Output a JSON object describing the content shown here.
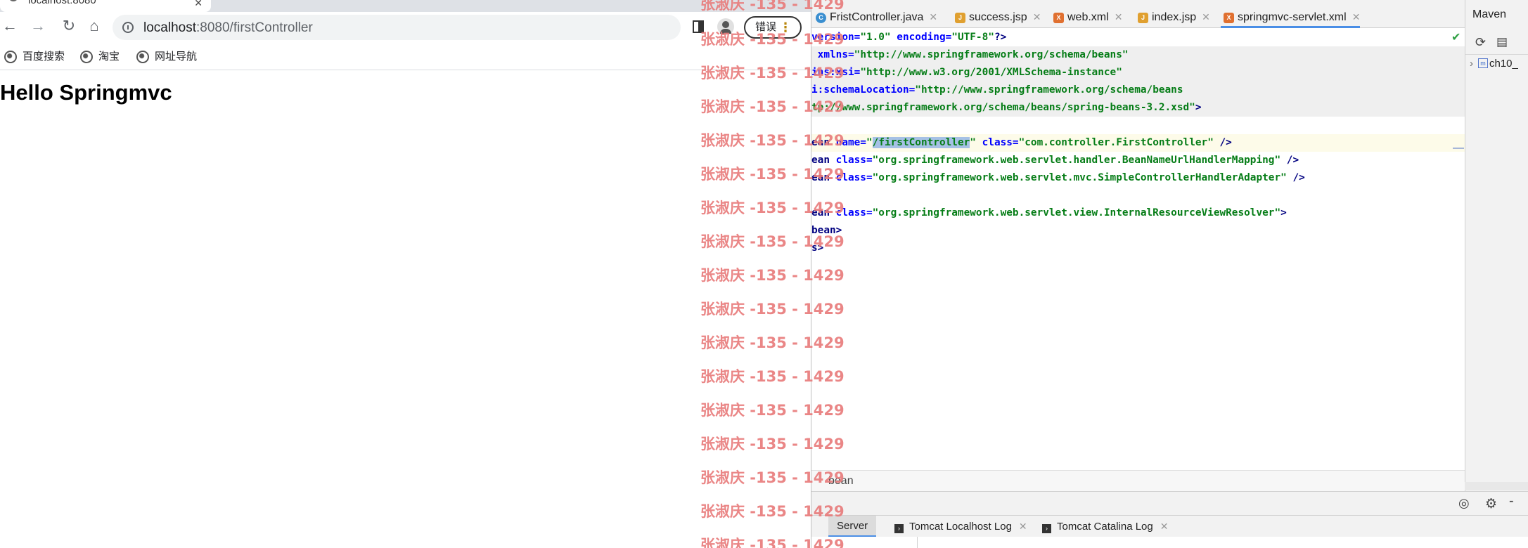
{
  "browser": {
    "tab_title": "localhost:8080",
    "url_host": "localhost",
    "url_path": ":8080/firstController",
    "error_button_label": "错误",
    "bookmarks": [
      "百度搜索",
      "淘宝",
      "网址导航"
    ],
    "page_heading": "Hello Springmvc"
  },
  "watermark": "张淑庆 -135 - 1429",
  "ide": {
    "tabs": [
      {
        "label": "FristController.java",
        "icon": "class-icon"
      },
      {
        "label": "success.jsp",
        "icon": "jsp-icon"
      },
      {
        "label": "web.xml",
        "icon": "xml-icon"
      },
      {
        "label": "index.jsp",
        "icon": "jsp-icon"
      },
      {
        "label": "springmvc-servlet.xml",
        "icon": "xml-icon",
        "active": true
      }
    ],
    "code": {
      "l1_a": "version=",
      "l1_b": "\"1.0\"",
      "l1_c": " encoding=",
      "l1_d": "\"UTF-8\"",
      "l1_e": "?>",
      "l2_a": " xmlns=",
      "l2_b": "\"http://www.springframework.org/schema/beans\"",
      "l3_a": "ins:xsi=",
      "l3_b": "\"http://www.w3.org/2001/XMLSchema-instance\"",
      "l4_a": "i:schemaLocation=",
      "l4_b": "\"http://www.springframework.org/schema/beans",
      "l5_a": "tp://www.springframework.org/schema/beans/spring-beans-3.2.xsd\"",
      "l5_b": ">",
      "l7_a": "ean ",
      "l7_b": "name=",
      "l7_c": "\"",
      "l7_d": "/firstController",
      "l7_e": "\"",
      "l7_f": " class=",
      "l7_g": "\"com.controller.FirstController\"",
      "l7_h": " />",
      "l8_a": "ean ",
      "l8_b": "class=",
      "l8_c": "\"org.springframework.web.servlet.handler.BeanNameUrlHandlerMapping\"",
      "l8_d": " />",
      "l9_a": "ean ",
      "l9_b": "class=",
      "l9_c": "\"org.springframework.web.servlet.mvc.SimpleControllerHandlerAdapter\"",
      "l9_d": " />",
      "l11_a": "ean ",
      "l11_b": "class=",
      "l11_c": "\"org.springframework.web.servlet.view.InternalResourceViewResolver\"",
      "l11_d": ">",
      "l12": "bean>",
      "l13": "s>"
    },
    "breadcrumb": "bean",
    "maven_title": "Maven",
    "maven_item": "ch10_",
    "run_tabs": [
      "Server",
      "Tomcat Localhost Log",
      "Tomcat Catalina Log"
    ]
  }
}
